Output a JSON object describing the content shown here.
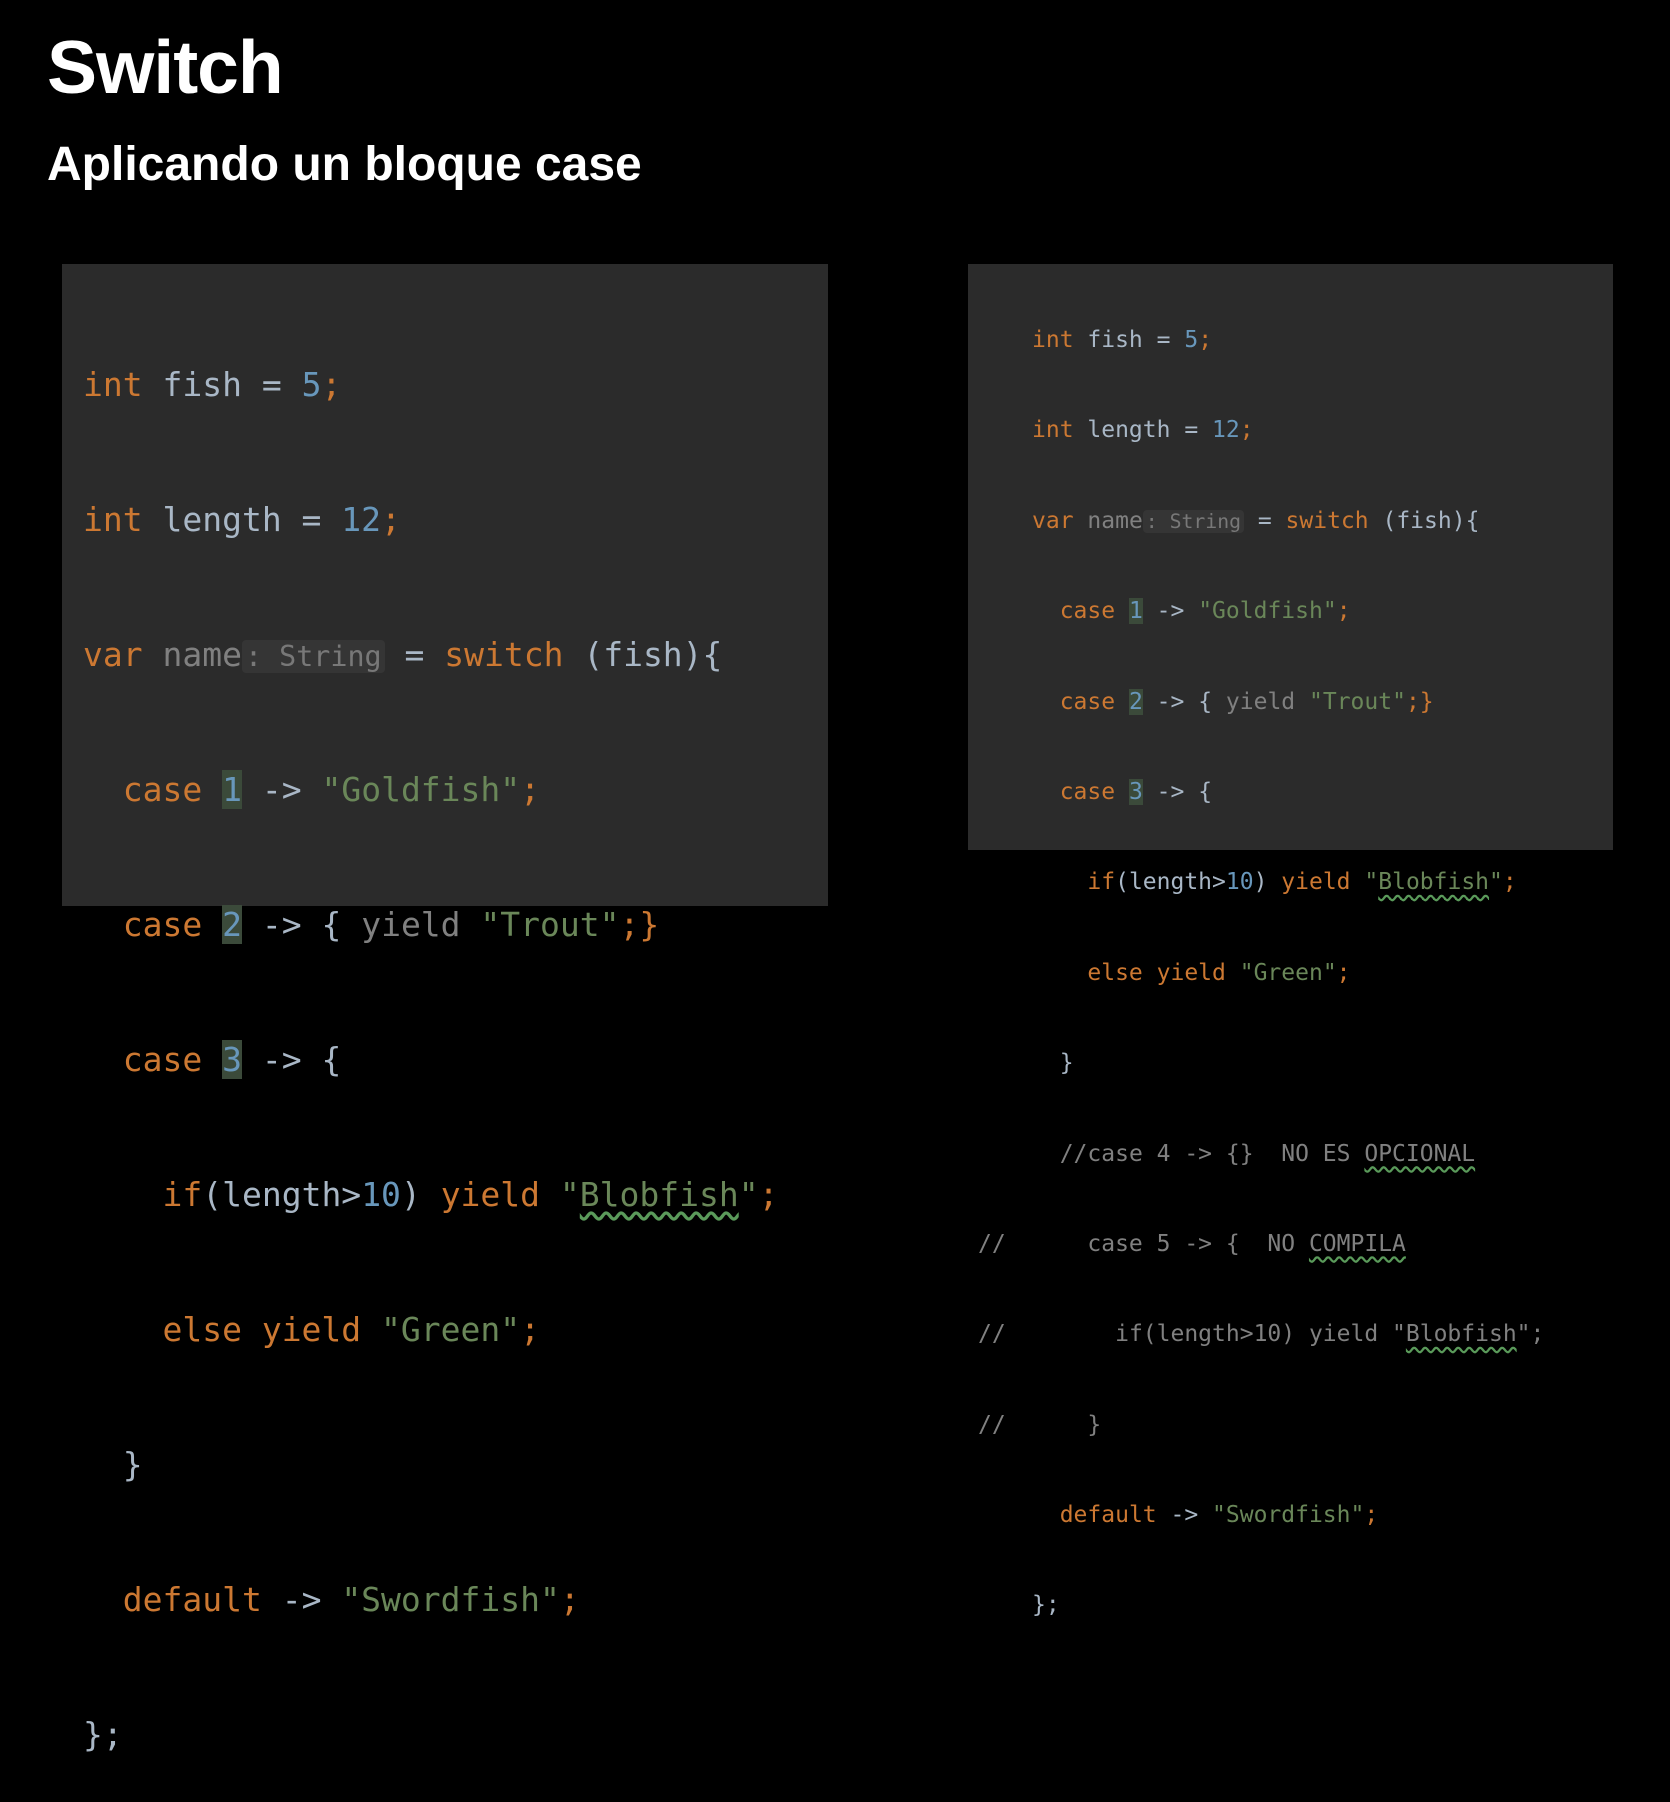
{
  "slide": {
    "title": "Switch",
    "subtitle": "Aplicando un bloque case"
  },
  "colors": {
    "background": "#000000",
    "panel": "#2b2b2b",
    "keyword": "#cc7832",
    "string": "#6a8759",
    "number": "#6897bb",
    "text": "#a9b7c6",
    "comment": "#808080"
  },
  "left_code": {
    "l1": {
      "kw": "int",
      "rest": " fish = ",
      "num": "5",
      "end": ";"
    },
    "l2": {
      "kw": "int",
      "rest": " length = ",
      "num": "12",
      "end": ";"
    },
    "l3": {
      "kw": "var",
      "var": "name",
      "hint": ": String",
      "eq": " = ",
      "kw2": "switch",
      "rest": " (fish){"
    },
    "l4": {
      "kw": "case",
      "num": "1",
      "arrow": " -> ",
      "str": "\"Goldfish\"",
      "end": ";"
    },
    "l5": {
      "kw": "case",
      "num": "2",
      "arrow": " -> { ",
      "dim": "yield",
      "str": "\"Trout\"",
      "end": ";}"
    },
    "l6": {
      "kw": "case",
      "num": "3",
      "arrow": " -> {"
    },
    "l7": {
      "kw": "if",
      "rest": "(length>",
      "num": "10",
      "rest2": ") ",
      "kw2": "yield",
      "q1": "\"",
      "str": "Blobfish",
      "q2": "\"",
      "end": ";"
    },
    "l8": {
      "kw": "else yield",
      "str": "\"Green\"",
      "end": ";"
    },
    "l9": {
      "text": "}"
    },
    "l10": {
      "kw": "default",
      "arrow": " -> ",
      "str": "\"Swordfish\"",
      "end": ";"
    },
    "l11": {
      "text": "};"
    }
  },
  "right_code": {
    "l1": {
      "kw": "int",
      "rest": " fish = ",
      "num": "5",
      "end": ";"
    },
    "l2": {
      "kw": "int",
      "rest": " length = ",
      "num": "12",
      "end": ";"
    },
    "l3": {
      "kw": "var",
      "var": "name",
      "hint": ": String",
      "eq": " = ",
      "kw2": "switch",
      "rest": " (fish){"
    },
    "l4": {
      "kw": "case",
      "num": "1",
      "arrow": " -> ",
      "str": "\"Goldfish\"",
      "end": ";"
    },
    "l5": {
      "kw": "case",
      "num": "2",
      "arrow": " -> { ",
      "dim": "yield",
      "str": "\"Trout\"",
      "end": ";}"
    },
    "l6": {
      "kw": "case",
      "num": "3",
      "arrow": " -> {"
    },
    "l7": {
      "kw": "if",
      "rest": "(length>",
      "num": "10",
      "rest2": ") ",
      "kw2": "yield",
      "q1": "\"",
      "str": "Blobfish",
      "q2": "\"",
      "end": ";"
    },
    "l8": {
      "kw": "else yield",
      "str": "\"Green\"",
      "end": ";"
    },
    "l9": {
      "text": "}"
    },
    "l10": {
      "comment": "//case 4 -> {}  NO ES ",
      "wavy": "OPCIONAL"
    },
    "l11": {
      "gutter": "//",
      "comment": "case 5 -> {  NO ",
      "wavy": "COMPILA"
    },
    "l12": {
      "gutter": "//",
      "comment": "if(length>10) yield \"",
      "wavy": "Blobfish",
      "comment2": "\";"
    },
    "l13": {
      "gutter": "//",
      "comment": "}"
    },
    "l14": {
      "kw": "default",
      "arrow": " -> ",
      "str": "\"Swordfish\"",
      "end": ";"
    },
    "l15": {
      "text": "};"
    }
  }
}
